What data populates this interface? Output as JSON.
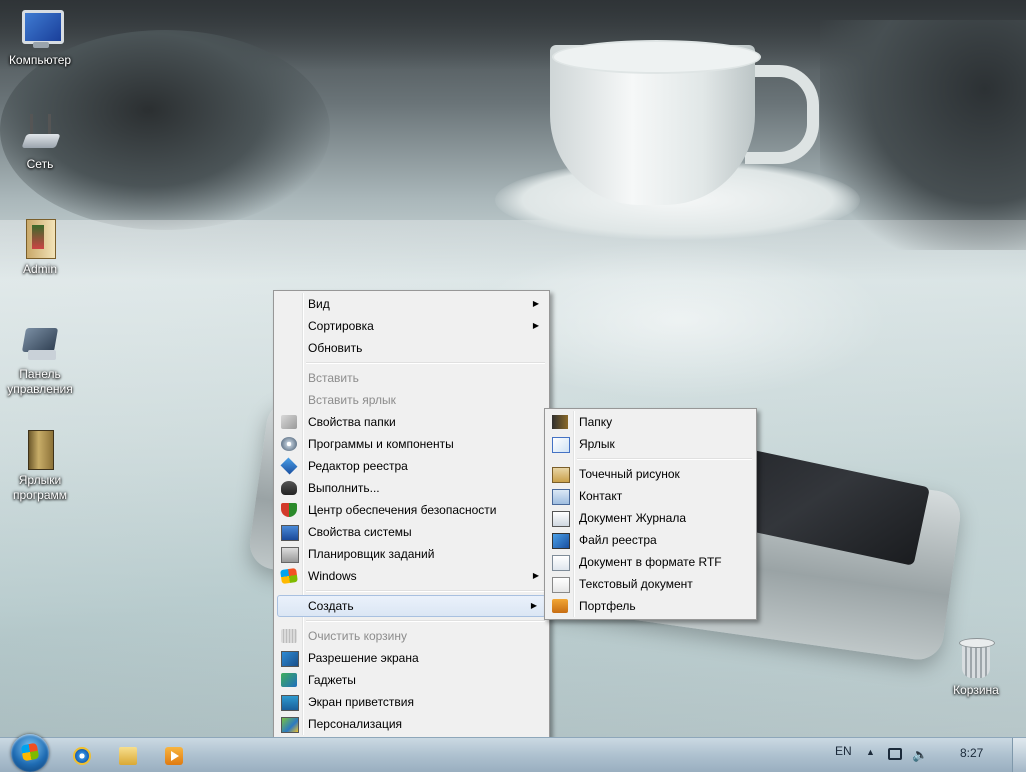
{
  "desktop": {
    "icons": [
      {
        "label": "Компьютер",
        "icon": "computer-icon"
      },
      {
        "label": "Сеть",
        "icon": "network-icon"
      },
      {
        "label": "Admin",
        "icon": "user-folder-icon"
      },
      {
        "label": "Панель управления",
        "icon": "control-panel-icon"
      },
      {
        "label": "Ярлыки программ",
        "icon": "program-shortcuts-icon"
      },
      {
        "label": "Корзина",
        "icon": "recycle-bin-icon"
      }
    ]
  },
  "context_menu": {
    "items": [
      {
        "label": "Вид",
        "submenu": true
      },
      {
        "label": "Сортировка",
        "submenu": true
      },
      {
        "label": "Обновить"
      },
      {
        "label": "Вставить",
        "disabled": true
      },
      {
        "label": "Вставить ярлык",
        "disabled": true
      },
      {
        "label": "Свойства папки",
        "icon": "folder-options-icon"
      },
      {
        "label": "Программы и компоненты",
        "icon": "programs-icon"
      },
      {
        "label": "Редактор реестра",
        "icon": "registry-editor-icon"
      },
      {
        "label": "Выполнить...",
        "icon": "run-icon"
      },
      {
        "label": "Центр обеспечения безопасности",
        "icon": "security-shield-icon"
      },
      {
        "label": "Свойства системы",
        "icon": "system-properties-icon"
      },
      {
        "label": "Планировщик заданий",
        "icon": "task-scheduler-icon"
      },
      {
        "label": "Windows",
        "icon": "windows-logo-icon",
        "submenu": true
      },
      {
        "label": "Создать",
        "submenu": true,
        "highlighted": true
      },
      {
        "label": "Очистить корзину",
        "icon": "empty-recycle-bin-icon",
        "disabled": true
      },
      {
        "label": "Разрешение экрана",
        "icon": "screen-resolution-icon"
      },
      {
        "label": "Гаджеты",
        "icon": "gadgets-icon"
      },
      {
        "label": "Экран приветствия",
        "icon": "welcome-screen-icon"
      },
      {
        "label": "Персонализация",
        "icon": "personalization-icon"
      }
    ]
  },
  "submenu_create": {
    "items": [
      {
        "label": "Папку",
        "icon": "folder-icon"
      },
      {
        "label": "Ярлык",
        "icon": "shortcut-icon"
      },
      {
        "label": "Точечный рисунок",
        "icon": "bitmap-image-icon"
      },
      {
        "label": "Контакт",
        "icon": "contact-card-icon"
      },
      {
        "label": "Документ Журнала",
        "icon": "journal-document-icon"
      },
      {
        "label": "Файл реестра",
        "icon": "registry-file-icon"
      },
      {
        "label": "Документ в формате RTF",
        "icon": "rtf-document-icon"
      },
      {
        "label": "Текстовый документ",
        "icon": "text-document-icon"
      },
      {
        "label": "Портфель",
        "icon": "briefcase-icon"
      }
    ]
  },
  "taskbar": {
    "pinned": [
      {
        "icon": "internet-explorer-icon"
      },
      {
        "icon": "windows-explorer-icon"
      },
      {
        "icon": "media-player-icon"
      }
    ],
    "language": "EN",
    "clock": "8:27"
  },
  "colors": {
    "menu_bg": "#f0f0f0",
    "menu_highlight": "#dbe6f4",
    "taskbar": "#a9bccb",
    "disabled_text": "#8c8c8c"
  }
}
